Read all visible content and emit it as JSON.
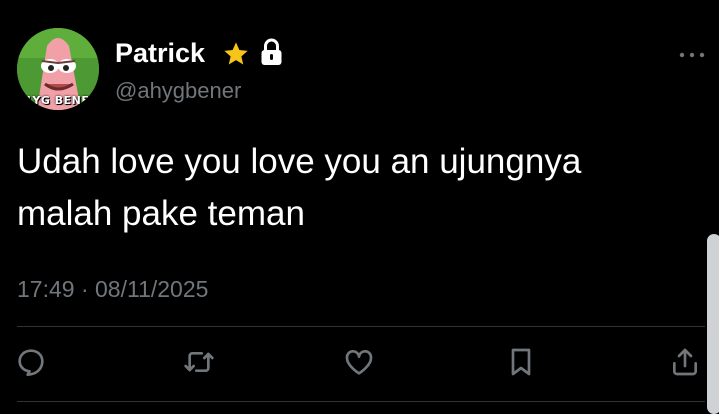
{
  "tweet": {
    "author": {
      "display_name": "Patrick",
      "handle": "@ahygbener",
      "avatar_caption": "LYG BENE"
    },
    "text": "Udah love you love you an ujungnya\nmalah pake teman",
    "time": "17:49",
    "separator": "·",
    "date": "08/11/2025"
  },
  "icons": {
    "badge": "star-icon",
    "protected": "lock-icon",
    "menu": "more-icon",
    "actions": [
      "reply-icon",
      "retweet-icon",
      "like-icon",
      "bookmark-icon",
      "share-icon"
    ]
  },
  "colors": {
    "background": "#000000",
    "text_primary": "#ffffff",
    "text_secondary": "#71767b",
    "star": "#f5c518",
    "divider": "#2f3336"
  }
}
